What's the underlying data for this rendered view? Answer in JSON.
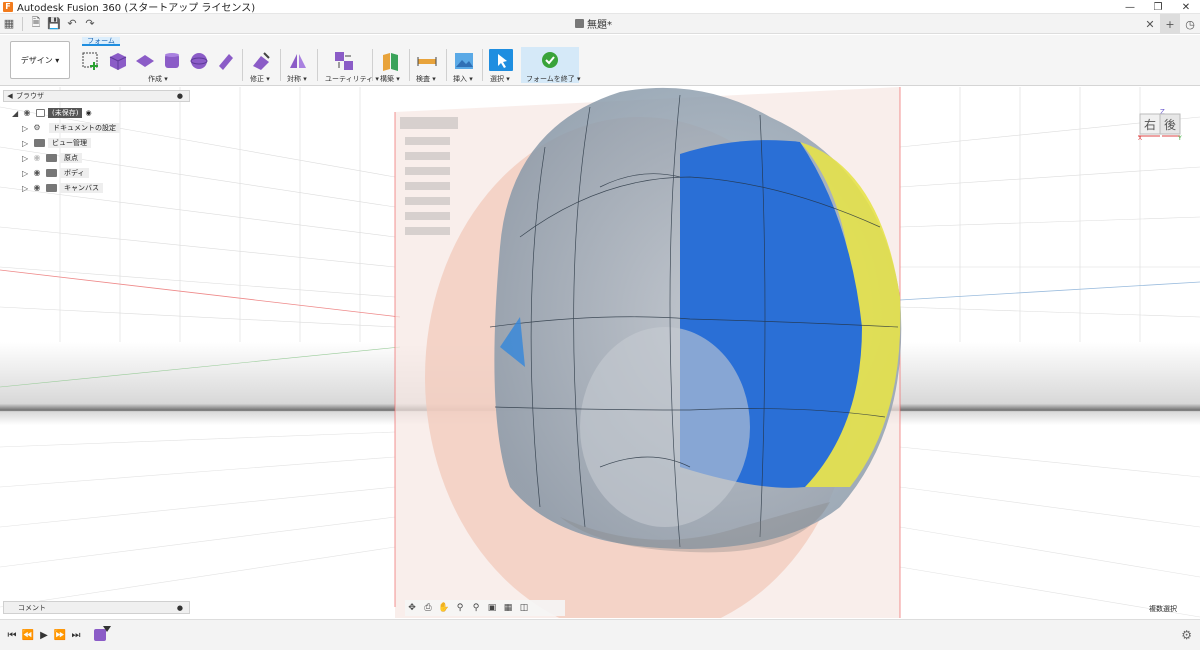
{
  "titlebar": {
    "title": "Autodesk Fusion 360 (スタートアップ ライセンス)",
    "app_icon": "F"
  },
  "document": {
    "tab_title": "無題*"
  },
  "ribbon": {
    "workspace_button": "デザイン ▾",
    "active_tab": "フォーム",
    "groups": [
      {
        "label": "作成 ▾"
      },
      {
        "label": "修正 ▾"
      },
      {
        "label": "対称 ▾"
      },
      {
        "label": "ユーティリティ ▾"
      },
      {
        "label": "構築 ▾"
      },
      {
        "label": "検査 ▾"
      },
      {
        "label": "挿入 ▾"
      },
      {
        "label": "選択 ▾"
      },
      {
        "label": "フォームを終了 ▾"
      }
    ]
  },
  "browser": {
    "header": "ブラウザ",
    "root_label": "(未保存)",
    "items": [
      {
        "label": "ドキュメントの設定"
      },
      {
        "label": "ビュー管理"
      },
      {
        "label": "原点"
      },
      {
        "label": "ボディ"
      },
      {
        "label": "キャンバス"
      }
    ]
  },
  "comment": {
    "label": "コメント"
  },
  "status": {
    "selection": "複数選択"
  },
  "viewcube": {
    "right_face": "右",
    "back_face": "後",
    "axis_x": "X",
    "axis_y": "Y",
    "axis_z": "Z"
  },
  "colors": {
    "accent": "#1f8ee0",
    "body_blue": "#2a6fd6",
    "body_yellow": "#e6e24a",
    "canvas_pink": "#f1c9bb"
  }
}
